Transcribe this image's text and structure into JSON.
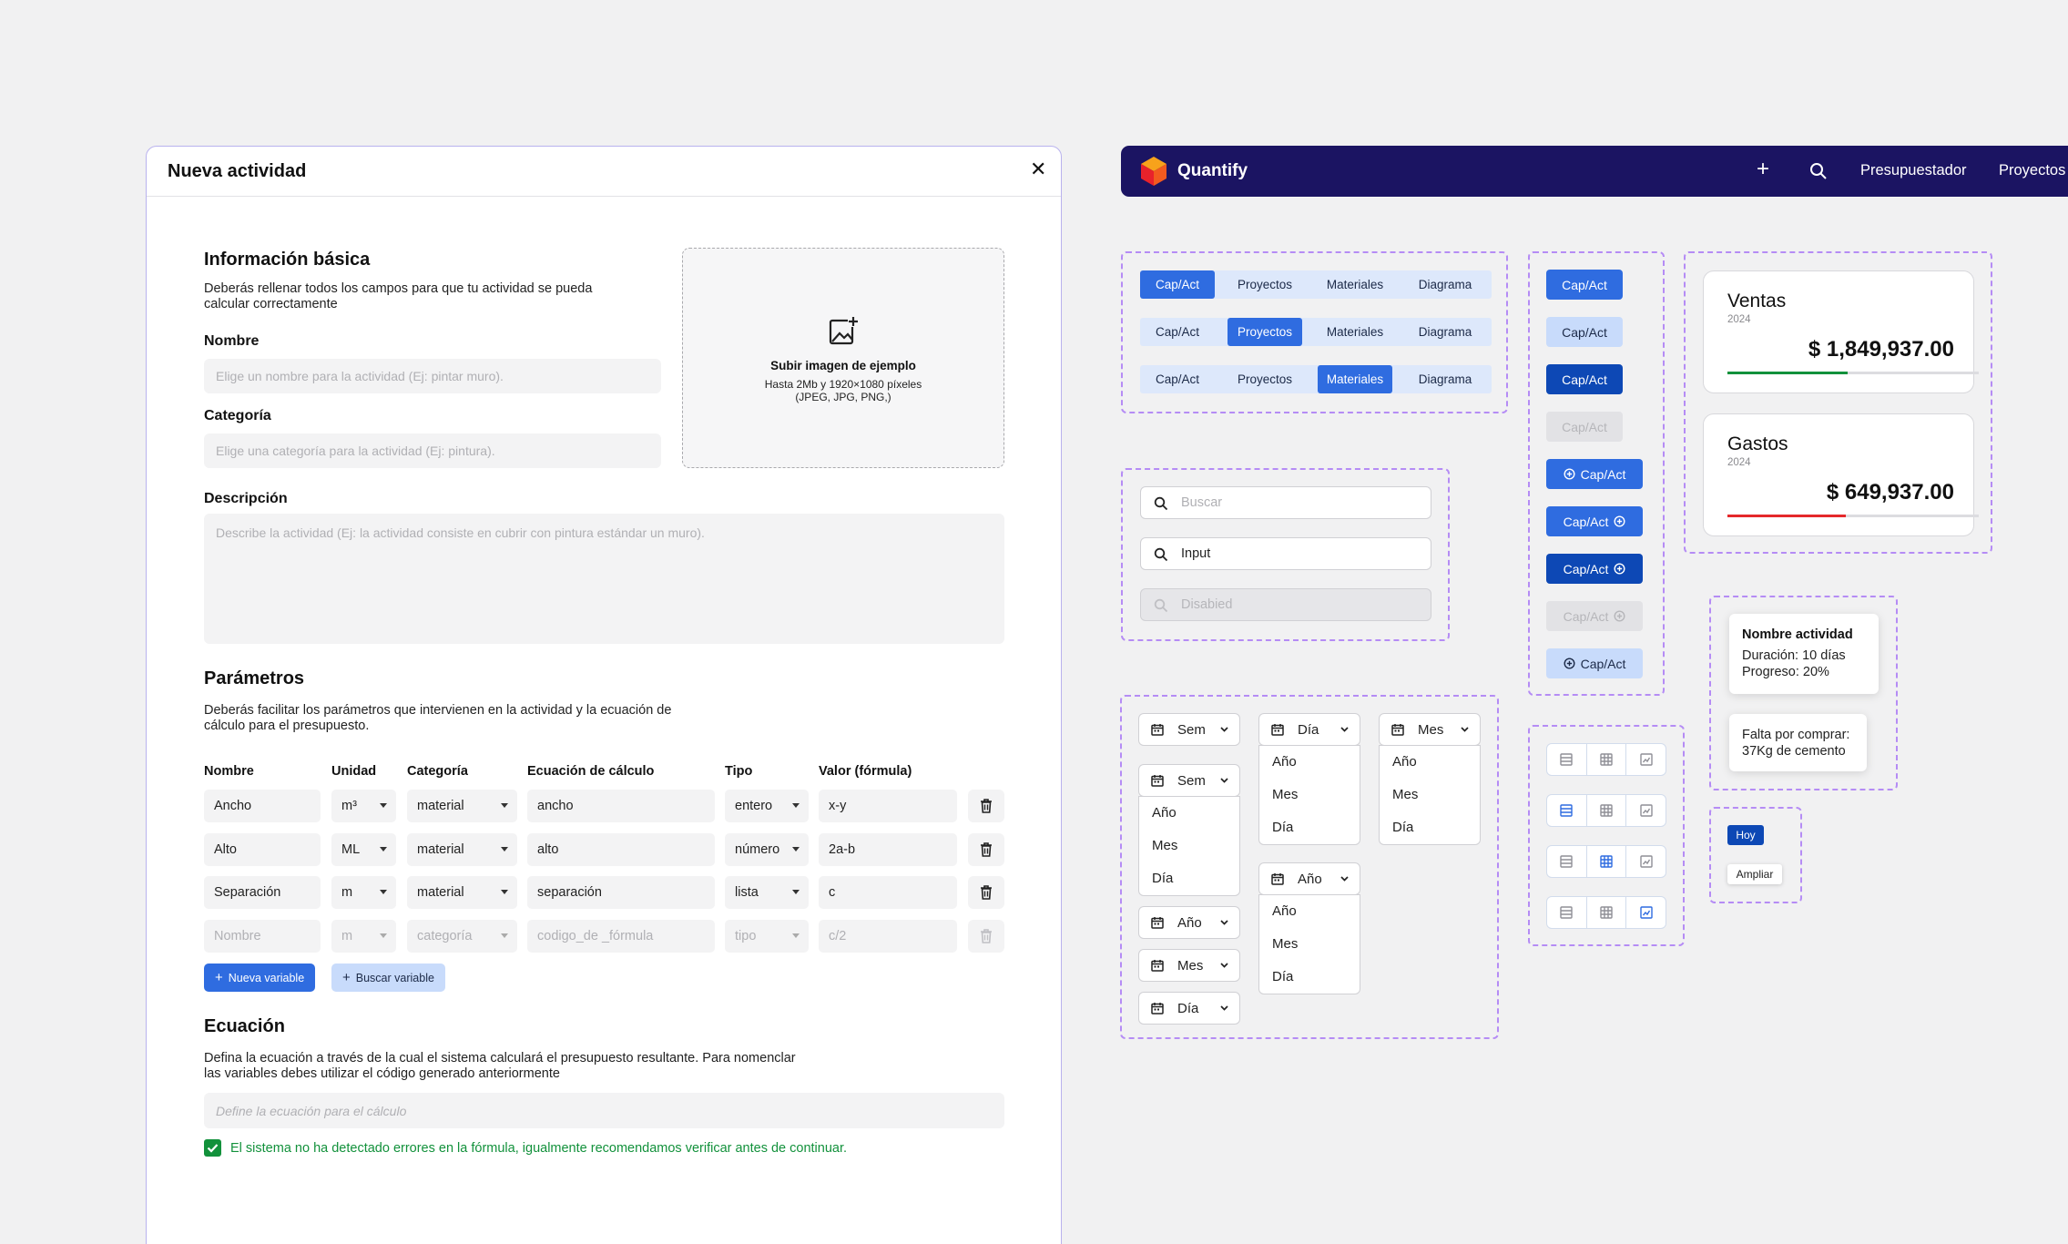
{
  "modal": {
    "title": "Nueva actividad",
    "basic": {
      "heading": "Información básica",
      "desc1": "Deberás rellenar todos los campos para que tu actividad se pueda",
      "desc2": "calcular correctamente",
      "name_label": "Nombre",
      "name_placeholder": "Elige un nombre para la actividad (Ej: pintar muro).",
      "category_label": "Categoría",
      "category_placeholder": "Elige una categoría para la actividad (Ej: pintura).",
      "description_label": "Descripción",
      "description_placeholder": "Describe la actividad (Ej: la actividad consiste en cubrir con pintura estándar un muro)."
    },
    "upload": {
      "title": "Subir imagen de ejemplo",
      "line1": "Hasta 2Mb y 1920×1080 píxeles",
      "line2": "(JPEG, JPG, PNG,)"
    },
    "params": {
      "heading": "Parámetros",
      "desc1": "Deberás facilitar los parámetros que intervienen en la actividad y la ecuación de",
      "desc2": "cálculo para el presupuesto.",
      "columns": [
        "Nombre",
        "Unidad",
        "Categoría",
        "Ecuación de cálculo",
        "Tipo",
        "Valor (fórmula)"
      ],
      "rows": [
        {
          "name": "Ancho",
          "unit": "m³",
          "category": "material",
          "equation": "ancho",
          "type": "entero",
          "value": "x-y"
        },
        {
          "name": "Alto",
          "unit": "ML",
          "category": "material",
          "equation": "alto",
          "type": "número",
          "value": "2a-b"
        },
        {
          "name": "Separación",
          "unit": "m",
          "category": "material",
          "equation": "separación",
          "type": "lista",
          "value": "c"
        }
      ],
      "placeholder_row": {
        "name": "Nombre",
        "unit": "m",
        "category": "categoría",
        "equation": "codigo_de _fórmula",
        "type": "tipo",
        "value": "c/2"
      },
      "new_variable": "Nueva variable",
      "search_variable": "Buscar variable"
    },
    "equation": {
      "heading": "Ecuación",
      "desc1": "Defina la ecuación a través de la cual el sistema calculará el presupuesto resultante. Para nomenclar",
      "desc2": "las variables debes utilizar el código generado anteriormente",
      "placeholder": "Define la ecuación para el cálculo",
      "success": "El sistema no ha detectado errores en la fórmula, igualmente recomendamos verificar antes de continuar."
    }
  },
  "nav": {
    "brand": "Quantify",
    "links": [
      "Presupuestador",
      "Proyectos"
    ]
  },
  "segments": {
    "items": [
      "Cap/Act",
      "Proyectos",
      "Materiales",
      "Diagrama"
    ]
  },
  "buttons": {
    "label": "Cap/Act"
  },
  "search": {
    "placeholder": "Buscar",
    "value": "Input",
    "disabled": "Disabied"
  },
  "kpi": [
    {
      "title": "Ventas",
      "year": "2024",
      "amount": "$ 1,849,937.00",
      "progress": 0.48,
      "color": "#12913b"
    },
    {
      "title": "Gastos",
      "year": "2024",
      "amount": "$ 649,937.00",
      "progress": 0.47,
      "color": "#e5282b"
    }
  ],
  "dropdowns": {
    "sem": "Sem",
    "dia": "Día",
    "mes": "Mes",
    "ano": "Año",
    "options": [
      "Año",
      "Mes",
      "Día"
    ]
  },
  "tooltips": {
    "activity_name": "Nombre actividad",
    "duration": "Duración: 10 días",
    "progress": "Progreso: 20%",
    "missing1": "Falta por comprar:",
    "missing2": "37Kg de cemento"
  },
  "small": {
    "today": "Hoy",
    "expand": "Ampliar"
  },
  "colors": {
    "primary": "#2f6ce0",
    "nav": "#1b1462",
    "success": "#12913b",
    "danger": "#e5282b"
  }
}
